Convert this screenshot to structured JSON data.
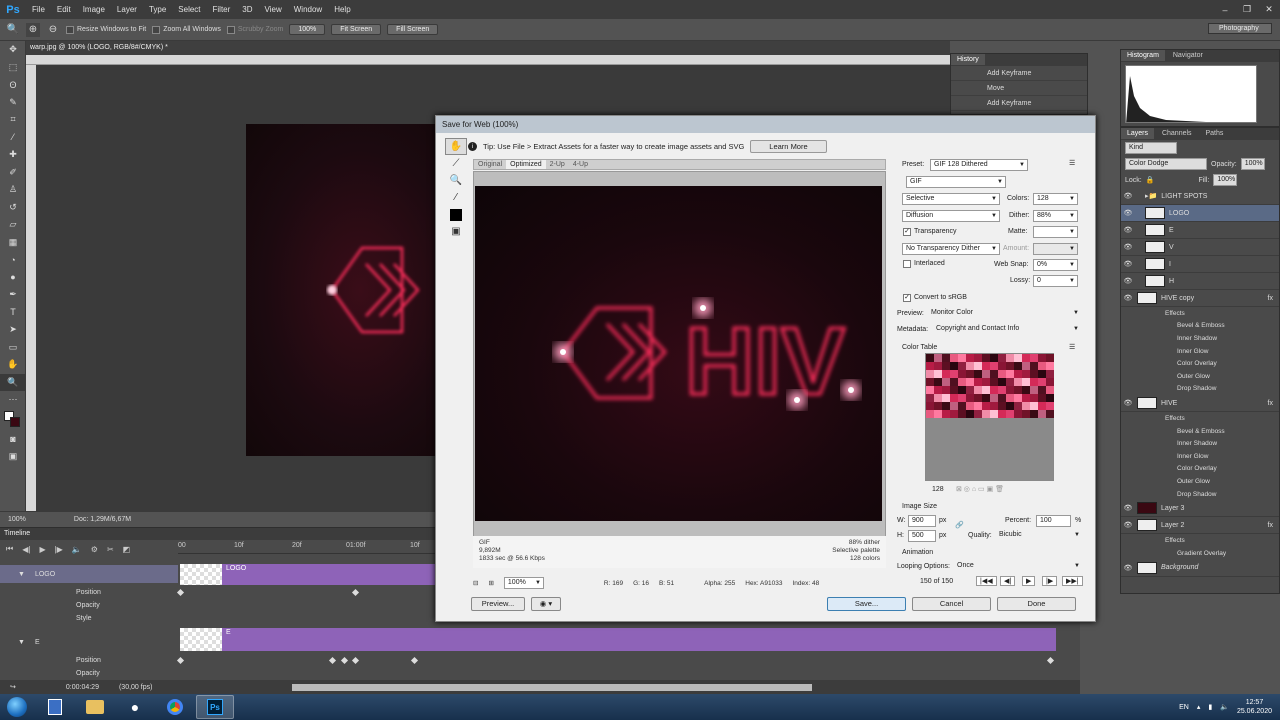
{
  "menu": {
    "app": "Ps",
    "items": [
      "File",
      "Edit",
      "Image",
      "Layer",
      "Type",
      "Select",
      "Filter",
      "3D",
      "View",
      "Window",
      "Help"
    ]
  },
  "options": {
    "resize_windows": "Resize Windows to Fit",
    "zoom_all": "Zoom All Windows",
    "scrubby": "Scrubby Zoom",
    "zoom_value": "100%",
    "fit_screen": "Fit Screen",
    "fill_screen": "Fill Screen",
    "workspace": "Photography"
  },
  "document": {
    "tab": "warp.jpg @ 100% (LOGO, RGB/8#/CMYK) *",
    "zoom": "100%",
    "doc_size": "Doc: 1,29M/6,67M"
  },
  "timeline": {
    "title": "Timeline",
    "ticks": [
      "00",
      "10f",
      "20f",
      "01:00f",
      "10f"
    ],
    "rows": {
      "logo": "LOGO",
      "e": "E",
      "position": "Position",
      "opacity": "Opacity",
      "style": "Style"
    },
    "bar_labels": {
      "logo": "LOGO",
      "e": "E"
    },
    "time": "0:00:04:29",
    "fps": "(30,00 fps)"
  },
  "history": {
    "tab": "History",
    "items": [
      "Add Keyframe",
      "Move",
      "Add Keyframe"
    ]
  },
  "histogram": {
    "tabs": [
      "Histogram",
      "Navigator"
    ]
  },
  "layers_panel": {
    "tabs": [
      "Layers",
      "Channels",
      "Paths"
    ],
    "kind": "Kind",
    "blend": "Color Dodge",
    "opacity_label": "Opacity:",
    "opacity": "100%",
    "lock_label": "Lock:",
    "fill_label": "Fill:",
    "fill": "100%",
    "light_spots": "LIGHT SPOTS",
    "logo": "LOGO",
    "e": "E",
    "v": "V",
    "i": "I",
    "h": "H",
    "hive_copy": "HIVE copy",
    "hive": "HIVE",
    "effects": "Effects",
    "bevel": "Bevel & Emboss",
    "inner_shadow": "Inner Shadow",
    "inner_glow": "Inner Glow",
    "color_overlay": "Color Overlay",
    "outer_glow": "Outer Glow",
    "drop_shadow": "Drop Shadow",
    "layer3": "Layer 3",
    "layer2": "Layer 2",
    "gradient_overlay": "Gradient Overlay",
    "background": "Background"
  },
  "dialog": {
    "title": "Save for Web (100%)",
    "tip": "Tip: Use File > Extract Assets for a faster way to create image assets and SVG",
    "learn_more": "Learn More",
    "view_tabs": [
      "Original",
      "Optimized",
      "2-Up",
      "4-Up"
    ],
    "preview_text": "HIV",
    "info_left": [
      "GIF",
      "9,892M",
      "1833 sec @ 56.6 Kbps"
    ],
    "info_right": [
      "88% dither",
      "Selective palette",
      "128 colors"
    ],
    "zoom": "100%",
    "r": "R: 169",
    "g": "G: 16",
    "b": "B: 51",
    "alpha": "Alpha: 255",
    "hex": "Hex: A91033",
    "index": "Index: 48",
    "preset_label": "Preset:",
    "preset": "GIF 128 Dithered",
    "format": "GIF",
    "reduction": "Selective",
    "colors_label": "Colors:",
    "colors": "128",
    "dither_algo": "Diffusion",
    "dither_label": "Dither:",
    "dither": "88%",
    "transparency": "Transparency",
    "matte_label": "Matte:",
    "trans_dither": "No Transparency Dither",
    "amount_label": "Amount:",
    "interlaced": "Interlaced",
    "websnap_label": "Web Snap:",
    "websnap": "0%",
    "lossy_label": "Lossy:",
    "lossy": "0",
    "convert_srgb": "Convert to sRGB",
    "preview_label": "Preview:",
    "preview_value": "Monitor Color",
    "metadata_label": "Metadata:",
    "metadata_value": "Copyright and Contact Info",
    "color_table": "Color Table",
    "ct_count": "128",
    "image_size": "Image Size",
    "w_label": "W:",
    "w": "900",
    "h_label": "H:",
    "h": "500",
    "px": "px",
    "percent_label": "Percent:",
    "percent": "100",
    "pct": "%",
    "quality_label": "Quality:",
    "quality": "Bicubic",
    "animation": "Animation",
    "looping_label": "Looping Options:",
    "looping": "Once",
    "frame": "150 of 150",
    "preview_btn": "Preview...",
    "save": "Save...",
    "cancel": "Cancel",
    "done": "Done"
  },
  "taskbar": {
    "lang": "EN",
    "time": "12:57",
    "date": "25.06.2020"
  }
}
